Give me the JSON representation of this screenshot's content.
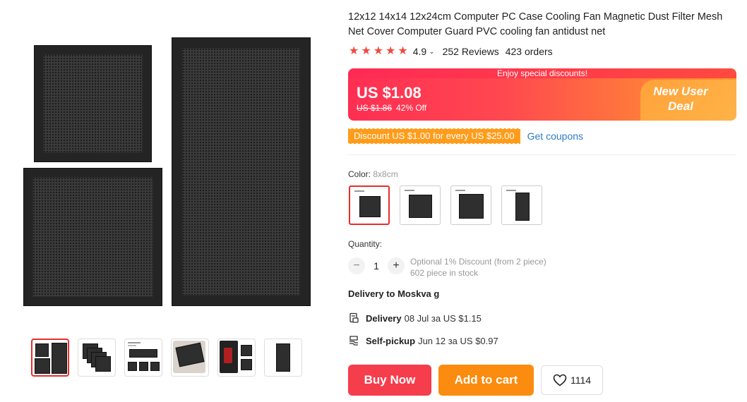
{
  "product": {
    "title": "12x12 14x14 12x24cm Computer PC Case Cooling Fan Magnetic Dust Filter Mesh Net Cover Computer Guard PVC cooling fan antidust net",
    "rating": "4.9",
    "reviews": "252 Reviews",
    "orders": "423 orders"
  },
  "price": {
    "banner_top": "Enjoy special discounts!",
    "current": "US $1.08",
    "original": "US $1.86",
    "discount": "42% Off",
    "deal_label": "New User Deal"
  },
  "coupon": {
    "tag": "Discount US $1.00 for every US $25.00",
    "link": "Get coupons"
  },
  "color": {
    "label": "Color: ",
    "selected": "8x8cm"
  },
  "quantity": {
    "label": "Quantity:",
    "minus": "−",
    "value": "1",
    "plus": "+",
    "note_line1": "Optional 1% Discount (from 2 piece)",
    "note_line2": "602 piece in stock"
  },
  "delivery": {
    "to": "Delivery to Moskva g",
    "option1_label": "Delivery",
    "option1_text": "08 Jul за US $1.15",
    "option2_label": "Self-pickup",
    "option2_text": "Jun 12 за US $0.97"
  },
  "actions": {
    "buy_now": "Buy Now",
    "add_to_cart": "Add to cart",
    "wishlist_count": "1114"
  },
  "colors": {
    "accent_red": "#f53d4b",
    "accent_orange": "#fb8c0f",
    "star": "#f04a3e",
    "link": "#2e7bc4"
  }
}
